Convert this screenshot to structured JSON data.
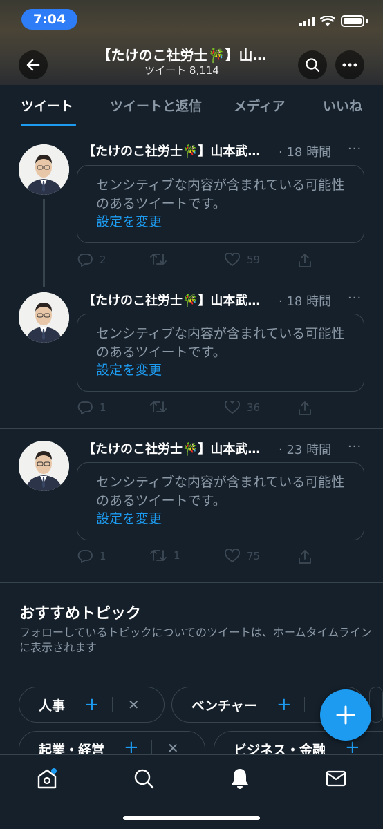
{
  "status_bar": {
    "time": "7:04"
  },
  "header": {
    "title": "【たけのこ社労士🎋】山…",
    "subtitle_label": "ツイート",
    "tweet_count": "8,114"
  },
  "tabs": [
    {
      "label": "ツイート",
      "active": true
    },
    {
      "label": "ツイートと返信",
      "active": false
    },
    {
      "label": "メディア",
      "active": false
    },
    {
      "label": "いいね",
      "active": false
    }
  ],
  "tweets": [
    {
      "author": "【たけのこ社労士🎋】山本武…",
      "time": "· 18 時間",
      "sensitive_text": "センシティブな内容が含まれている可能性のあるツイートです。",
      "settings_link": "設定を変更",
      "replies": "2",
      "retweets": "",
      "likes": "59"
    },
    {
      "author": "【たけのこ社労士🎋】山本武…",
      "time": "· 18 時間",
      "sensitive_text": "センシティブな内容が含まれている可能性のあるツイートです。",
      "settings_link": "設定を変更",
      "replies": "1",
      "retweets": "",
      "likes": "36"
    },
    {
      "author": "【たけのこ社労士🎋】山本武…",
      "time": "· 23 時間",
      "sensitive_text": "センシティブな内容が含まれている可能性のあるツイートです。",
      "settings_link": "設定を変更",
      "replies": "1",
      "retweets": "1",
      "likes": "75"
    }
  ],
  "topics": {
    "title": "おすすめトピック",
    "description": "フォローしているトピックについてのツイートは、ホームタイムラインに表示されます",
    "chips": [
      "人事",
      "ベンチャー",
      "起業・経営",
      "ビジネス・金融"
    ]
  },
  "colors": {
    "accent": "#1d9bf0",
    "background": "#15202b",
    "border": "#38444d",
    "muted": "#8b98a5"
  },
  "icons": {
    "back": "arrow-left-icon",
    "search": "search-icon",
    "more": "more-icon",
    "compose": "plus-icon",
    "home": "home-icon",
    "explore": "search-icon",
    "notifications": "bell-icon",
    "messages": "mail-icon"
  }
}
